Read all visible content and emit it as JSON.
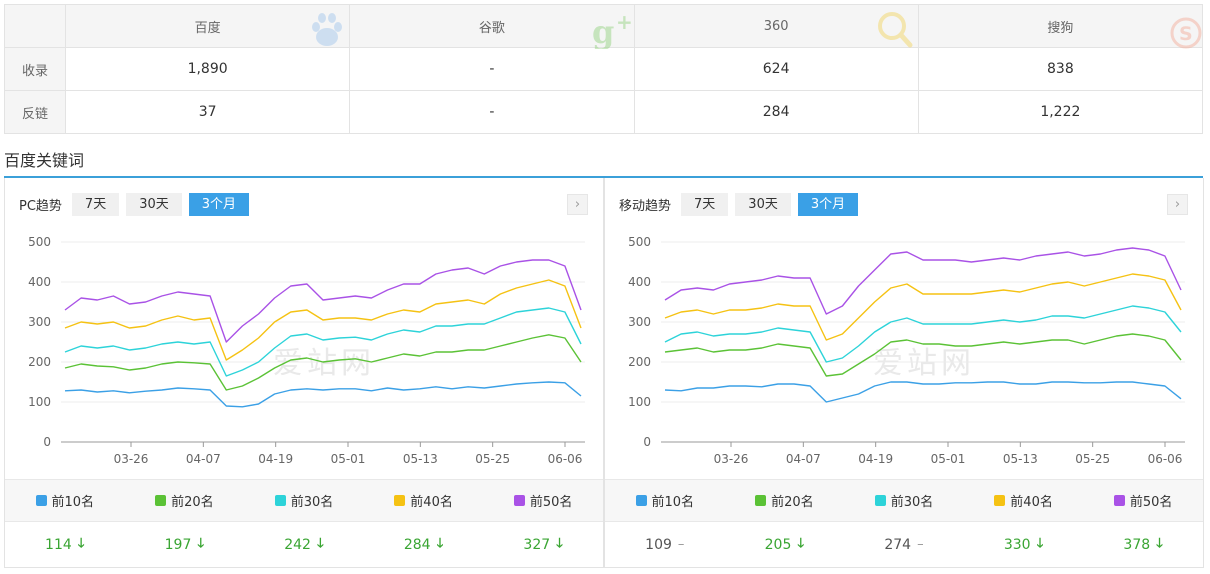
{
  "engines": {
    "header": [
      "百度",
      "谷歌",
      "360",
      "搜狗"
    ],
    "rows": [
      {
        "label": "收录",
        "values": [
          "1,890",
          "-",
          "624",
          "838"
        ]
      },
      {
        "label": "反链",
        "values": [
          "37",
          "-",
          "284",
          "1,222"
        ]
      }
    ],
    "icons": [
      "baidu-paw-icon",
      "google-plus-icon",
      "360-search-icon",
      "sogou-icon"
    ]
  },
  "section_title": "百度关键词",
  "watermark": "爱站网",
  "panels": [
    {
      "title": "PC趋势",
      "ranges": [
        "7天",
        "30天",
        "3个月"
      ],
      "active_range": "3个月",
      "legend": [
        "前10名",
        "前20名",
        "前30名",
        "前40名",
        "前50名"
      ],
      "values": [
        {
          "value": "114",
          "trend": "down"
        },
        {
          "value": "197",
          "trend": "down"
        },
        {
          "value": "242",
          "trend": "down"
        },
        {
          "value": "284",
          "trend": "down"
        },
        {
          "value": "327",
          "trend": "down"
        }
      ]
    },
    {
      "title": "移动趋势",
      "ranges": [
        "7天",
        "30天",
        "3个月"
      ],
      "active_range": "3个月",
      "legend": [
        "前10名",
        "前20名",
        "前30名",
        "前40名",
        "前50名"
      ],
      "values": [
        {
          "value": "109",
          "trend": "flat"
        },
        {
          "value": "205",
          "trend": "down"
        },
        {
          "value": "274",
          "trend": "flat"
        },
        {
          "value": "330",
          "trend": "down"
        },
        {
          "value": "378",
          "trend": "down"
        }
      ]
    }
  ],
  "series_colors": [
    "#3ba0e6",
    "#5bc236",
    "#2dd3d9",
    "#f5c213",
    "#a952e6"
  ],
  "chart_data": [
    {
      "type": "line",
      "title": "PC趋势",
      "x_ticks": [
        "03-26",
        "04-07",
        "04-19",
        "05-01",
        "05-13",
        "05-25",
        "06-06"
      ],
      "y_ticks": [
        0,
        100,
        200,
        300,
        400,
        500
      ],
      "ylim": [
        0,
        500
      ],
      "grid": true,
      "series": [
        {
          "name": "前10名",
          "values": [
            128,
            130,
            125,
            128,
            123,
            127,
            130,
            135,
            133,
            130,
            90,
            88,
            95,
            120,
            130,
            133,
            130,
            133,
            133,
            128,
            135,
            130,
            133,
            138,
            133,
            138,
            135,
            140,
            145,
            148,
            150,
            148,
            115
          ]
        },
        {
          "name": "前20名",
          "values": [
            185,
            195,
            190,
            188,
            180,
            185,
            195,
            200,
            198,
            195,
            130,
            140,
            160,
            185,
            205,
            210,
            200,
            205,
            208,
            200,
            210,
            220,
            215,
            225,
            225,
            230,
            230,
            240,
            250,
            260,
            268,
            260,
            200
          ]
        },
        {
          "name": "前30名",
          "values": [
            225,
            240,
            235,
            240,
            230,
            235,
            245,
            250,
            245,
            250,
            165,
            180,
            200,
            235,
            265,
            270,
            255,
            260,
            262,
            255,
            270,
            280,
            275,
            290,
            290,
            295,
            295,
            310,
            325,
            330,
            335,
            325,
            245
          ]
        },
        {
          "name": "前40名",
          "values": [
            285,
            300,
            295,
            300,
            285,
            290,
            305,
            315,
            305,
            310,
            205,
            230,
            260,
            300,
            325,
            330,
            305,
            310,
            310,
            305,
            320,
            330,
            325,
            345,
            350,
            355,
            345,
            370,
            385,
            395,
            405,
            390,
            285
          ]
        },
        {
          "name": "前50名",
          "values": [
            330,
            360,
            355,
            365,
            345,
            350,
            365,
            375,
            370,
            365,
            250,
            290,
            320,
            360,
            390,
            395,
            355,
            360,
            365,
            360,
            380,
            395,
            395,
            420,
            430,
            435,
            420,
            440,
            450,
            455,
            455,
            440,
            330
          ]
        }
      ]
    },
    {
      "type": "line",
      "title": "移动趋势",
      "x_ticks": [
        "03-26",
        "04-07",
        "04-19",
        "05-01",
        "05-13",
        "05-25",
        "06-06"
      ],
      "y_ticks": [
        0,
        100,
        200,
        300,
        400,
        500
      ],
      "ylim": [
        0,
        500
      ],
      "grid": true,
      "series": [
        {
          "name": "前10名",
          "values": [
            130,
            128,
            135,
            135,
            140,
            140,
            138,
            145,
            145,
            140,
            100,
            110,
            120,
            140,
            150,
            150,
            145,
            145,
            148,
            148,
            150,
            150,
            145,
            145,
            150,
            150,
            148,
            148,
            150,
            150,
            145,
            140,
            108
          ]
        },
        {
          "name": "前20名",
          "values": [
            225,
            230,
            235,
            225,
            230,
            230,
            235,
            245,
            240,
            235,
            165,
            170,
            195,
            220,
            250,
            255,
            245,
            245,
            240,
            240,
            245,
            250,
            245,
            250,
            255,
            255,
            245,
            255,
            265,
            270,
            265,
            255,
            205
          ]
        },
        {
          "name": "前30名",
          "values": [
            250,
            270,
            275,
            265,
            270,
            270,
            275,
            285,
            280,
            275,
            200,
            210,
            240,
            275,
            300,
            310,
            295,
            295,
            295,
            295,
            300,
            305,
            300,
            305,
            315,
            315,
            310,
            320,
            330,
            340,
            335,
            325,
            275
          ]
        },
        {
          "name": "前40名",
          "values": [
            310,
            325,
            330,
            320,
            330,
            330,
            335,
            345,
            340,
            340,
            255,
            270,
            310,
            350,
            385,
            395,
            370,
            370,
            370,
            370,
            375,
            380,
            375,
            385,
            395,
            400,
            390,
            400,
            410,
            420,
            415,
            405,
            330
          ]
        },
        {
          "name": "前50名",
          "values": [
            355,
            380,
            385,
            380,
            395,
            400,
            405,
            415,
            410,
            410,
            320,
            340,
            390,
            430,
            470,
            475,
            455,
            455,
            455,
            450,
            455,
            460,
            455,
            465,
            470,
            475,
            465,
            470,
            480,
            485,
            480,
            465,
            380
          ]
        }
      ]
    }
  ]
}
